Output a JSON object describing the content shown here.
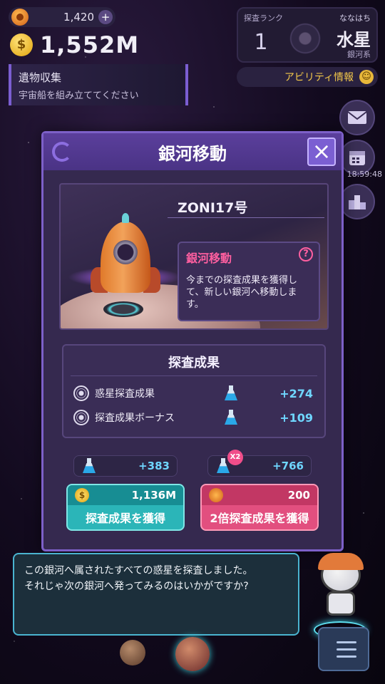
{
  "hud": {
    "gems": "1,420",
    "coins": "1,552M",
    "coin_symbol": "$"
  },
  "quest": {
    "title": "遺物収集",
    "description": "宇宙船を組み立ててください"
  },
  "rank_card": {
    "rank_label": "探査ランク",
    "rank_value": "1",
    "owner": "ななはち",
    "planet": "水星",
    "galaxy": "銀河系"
  },
  "ability": {
    "label": "アビリティ情報"
  },
  "side": {
    "timer": "18:59:48"
  },
  "dialog": {
    "title": "銀河移動",
    "ship_name": "ZONI17号",
    "info_title": "銀河移動",
    "info_description": "今までの探査成果を獲得して、新しい銀河へ移動します。",
    "results_title": "探査成果",
    "results": [
      {
        "label": "惑星探査成果",
        "value": "+274"
      },
      {
        "label": "探査成果ボーナス",
        "value": "+109"
      }
    ],
    "sum_normal": "+383",
    "sum_double": "+766",
    "double_badge": "X2",
    "claim_normal": {
      "cost": "1,136M",
      "label": "探査成果を獲得"
    },
    "claim_double": {
      "cost": "200",
      "label": "2倍探査成果を獲得"
    }
  },
  "narrator": {
    "line1": "この銀河へ属されたすべての惑星を探査しました。",
    "line2": "それじゃ次の銀河へ発ってみるのはいかがですか?"
  },
  "colors": {
    "dialog_bg": "#35294f",
    "accent_purple": "#7d60c8",
    "science_blue": "#6fd6ff",
    "teal_button": "#2bb5b8",
    "pink_button": "#e24f7f",
    "info_title_pink": "#ff5fa0",
    "ability_gold": "#f2c74a"
  }
}
